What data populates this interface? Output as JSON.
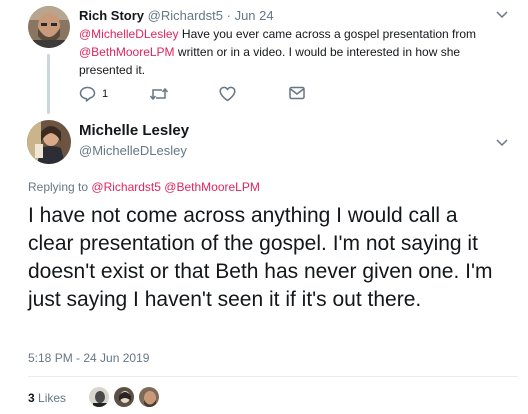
{
  "parent_tweet": {
    "author_name": "Rich Story",
    "author_handle": "@Richardst5",
    "separator": "·",
    "date": "Jun 24",
    "mention_1": "@MichelleDLesley",
    "text_1": " Have you ever came across a gospel presentation from",
    "mention_2": "@BethMooreLPM",
    "text_2": " written or in a video. I would be interested in how she presented it.",
    "reply_count": "1",
    "icons": [
      "reply-icon",
      "retweet-icon",
      "heart-icon",
      "message-icon",
      "chevron-down-icon"
    ]
  },
  "main_tweet": {
    "author_name": "Michelle Lesley",
    "author_handle": "@MichelleDLesley",
    "replying_label": "Replying to",
    "replying_mention_1": "@Richardst5",
    "replying_mention_2": "@BethMooreLPM",
    "text": "I have not come across anything I would call a clear presentation of the gospel. I'm not saying it doesn't exist or that Beth has never given one. I'm just saying I haven't seen it if it's out there.",
    "timestamp": "5:18 PM - 24 Jun 2019",
    "likes_count": "3",
    "likes_label": "Likes"
  },
  "colors": {
    "mention": "#e0245e",
    "muted": "#657786",
    "text": "#14171a",
    "thread_line": "#ccd6dd"
  }
}
